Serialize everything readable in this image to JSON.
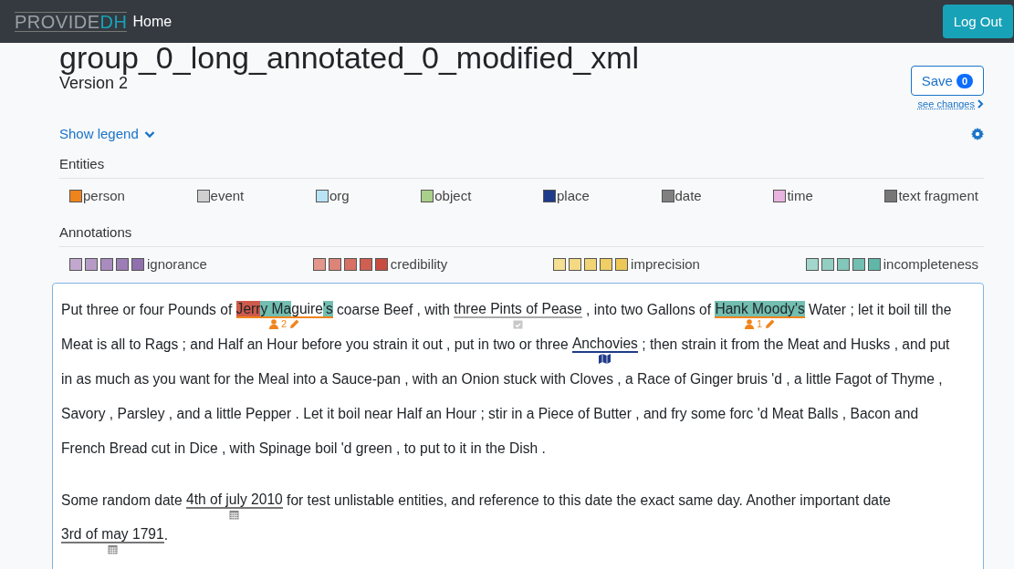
{
  "navbar": {
    "brand_gray": "PROVIDE",
    "brand_accent": "DH",
    "home": "Home",
    "logout": "Log Out"
  },
  "document": {
    "title": "group_0_long_annotated_0_modified_xml",
    "version": "Version 2",
    "save": "Save",
    "save_count": "0",
    "see_changes": "see changes"
  },
  "legend": {
    "toggle": "Show legend",
    "expanded": true,
    "entities_title": "Entities",
    "entities": [
      {
        "name": "person",
        "color": "#f0841c"
      },
      {
        "name": "event",
        "color": "#cfcfcf"
      },
      {
        "name": "org",
        "color": "#b8e4f5"
      },
      {
        "name": "object",
        "color": "#a9cf8a"
      },
      {
        "name": "place",
        "color": "#1e3a8a"
      },
      {
        "name": "date",
        "color": "#808080"
      },
      {
        "name": "time",
        "color": "#e8b4e0"
      },
      {
        "name": "text fragment",
        "color": "#777777"
      }
    ],
    "annotations_title": "Annotations",
    "annotations": [
      {
        "name": "ignorance",
        "swatches": [
          {
            "color": "#c2a8cf"
          },
          {
            "color": "#b59bc6"
          },
          {
            "color": "#a98cbf"
          },
          {
            "color": "#9d7db6"
          },
          {
            "color": "#9070ad"
          }
        ]
      },
      {
        "name": "credibility",
        "swatches": [
          {
            "color": "#e3978b"
          },
          {
            "color": "#dd8478"
          },
          {
            "color": "#d77164"
          },
          {
            "color": "#d05f52"
          },
          {
            "color": "#c94c40"
          }
        ]
      },
      {
        "name": "imprecision",
        "swatches": [
          {
            "color": "#f5df93"
          },
          {
            "color": "#f3d984"
          },
          {
            "color": "#f1d475"
          },
          {
            "color": "#efce66"
          },
          {
            "color": "#edc857"
          }
        ]
      },
      {
        "name": "incompleteness",
        "swatches": [
          {
            "color": "#a3d6cc"
          },
          {
            "color": "#93cec3"
          },
          {
            "color": "#83c6ba"
          },
          {
            "color": "#72beb1"
          },
          {
            "color": "#61b6a8"
          }
        ]
      }
    ]
  },
  "editor": {
    "paragraphs": [
      {
        "lines": [
          {
            "segments": [
              {
                "kind": "text",
                "text": "Put three or four Pounds of "
              },
              {
                "kind": "person",
                "color": "#f0841c",
                "count": "2",
                "parts": [
                  {
                    "text": "Jerr",
                    "color": "#cf5a4c"
                  },
                  {
                    "text": "y Ma",
                    "color": "#72beb1"
                  },
                  {
                    "text": "guire"
                  },
                  {
                    "text": "'s",
                    "color": "#72beb1"
                  }
                ]
              },
              {
                "kind": "text",
                "text": " coarse Beef , with "
              },
              {
                "kind": "event",
                "color": "#aaaaaa",
                "parts": [
                  {
                    "text": "three Pints of Pease"
                  }
                ]
              },
              {
                "kind": "text",
                "text": " , into two Gallons of "
              },
              {
                "kind": "person",
                "color": "#f0841c",
                "count": "1",
                "parts": [
                  {
                    "text": "Hank Moody's",
                    "color": "#72beb1"
                  }
                ]
              },
              {
                "kind": "text",
                "text": " Water ; let it boil till the"
              }
            ]
          },
          {
            "segments": [
              {
                "kind": "text",
                "text": "Meat is all to Rags ; and Half an Hour before you strain it out , put in two or three "
              },
              {
                "kind": "place",
                "color": "#1e3a8a",
                "parts": [
                  {
                    "text": "Anchovies"
                  }
                ]
              },
              {
                "kind": "text",
                "text": " ; then strain it from the Meat and Husks , and put"
              }
            ]
          },
          {
            "segments": [
              {
                "kind": "text",
                "text": "in as much as you want for the Meal into a Sauce-pan , with an Onion stuck with Cloves , a Race of Ginger bruis 'd , a little Fagot of Thyme ,"
              }
            ]
          },
          {
            "segments": [
              {
                "kind": "text",
                "text": "Savory , Parsley , and a little Pepper . Let it boil near Half an Hour ; stir in a Piece of Butter , and fry some forc 'd Meat Balls , Bacon and"
              }
            ]
          },
          {
            "segments": [
              {
                "kind": "text",
                "text": "French Bread cut in Dice , with Spinage boil 'd green , to put to it in the Dish ."
              }
            ]
          }
        ]
      },
      {
        "lines": [
          {
            "segments": [
              {
                "kind": "text",
                "text": "Some random date "
              },
              {
                "kind": "date",
                "color": "#777777",
                "parts": [
                  {
                    "text": "4th of july 2010"
                  }
                ]
              },
              {
                "kind": "text",
                "text": " for test unlistable entities, and reference to this date the exact same day. Another important date"
              }
            ]
          },
          {
            "segments": [
              {
                "kind": "date",
                "color": "#777777",
                "parts": [
                  {
                    "text": "3rd of may 1791"
                  }
                ]
              },
              {
                "kind": "text",
                "text": "."
              }
            ]
          }
        ]
      }
    ]
  }
}
